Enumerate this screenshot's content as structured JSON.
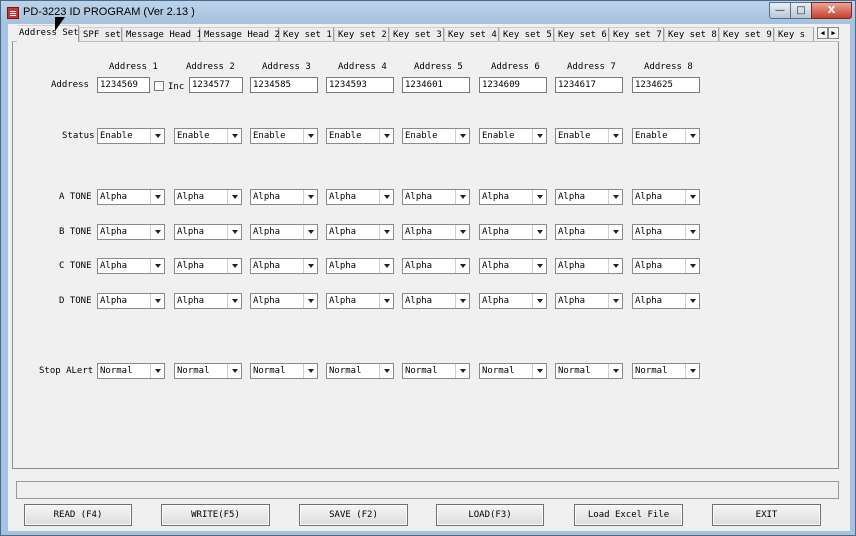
{
  "window": {
    "title": "PD-3223 ID PROGRAM (Ver 2.13 )",
    "caption_minimize": "—",
    "caption_maximize": "□",
    "caption_close": "X"
  },
  "tabs": [
    "Address Set",
    "SPF set",
    "Message Head 1",
    "Message Head 2",
    "Key set 1",
    "Key set 2",
    "Key set 3",
    "Key set 4",
    "Key set 5",
    "Key set 6",
    "Key set 7",
    "Key set 8",
    "Key set 9",
    "Key s"
  ],
  "active_tab": "Address Set",
  "tab_arrows": {
    "left": "◀",
    "right": "▶"
  },
  "form": {
    "row_labels": {
      "address": "Address",
      "status": "Status",
      "a_tone": "A TONE",
      "b_tone": "B TONE",
      "c_tone": "C TONE",
      "d_tone": "D TONE",
      "stop_alert": "Stop ALert"
    },
    "inc_label": "Inc",
    "inc_checked": false,
    "columns": [
      {
        "header": "Address 1",
        "address": "1234569",
        "status": "Enable",
        "a": "Alpha",
        "b": "Alpha",
        "c": "Alpha",
        "d": "Alpha",
        "stop": "Normal"
      },
      {
        "header": "Address  2",
        "address": "1234577",
        "status": "Enable",
        "a": "Alpha",
        "b": "Alpha",
        "c": "Alpha",
        "d": "Alpha",
        "stop": "Normal"
      },
      {
        "header": "Address  3",
        "address": "1234585",
        "status": "Enable",
        "a": "Alpha",
        "b": "Alpha",
        "c": "Alpha",
        "d": "Alpha",
        "stop": "Normal"
      },
      {
        "header": "Address  4",
        "address": "1234593",
        "status": "Enable",
        "a": "Alpha",
        "b": "Alpha",
        "c": "Alpha",
        "d": "Alpha",
        "stop": "Normal"
      },
      {
        "header": "Address  5",
        "address": "1234601",
        "status": "Enable",
        "a": "Alpha",
        "b": "Alpha",
        "c": "Alpha",
        "d": "Alpha",
        "stop": "Normal"
      },
      {
        "header": "Address  6",
        "address": "1234609",
        "status": "Enable",
        "a": "Alpha",
        "b": "Alpha",
        "c": "Alpha",
        "d": "Alpha",
        "stop": "Normal"
      },
      {
        "header": "Address  7",
        "address": "1234617",
        "status": "Enable",
        "a": "Alpha",
        "b": "Alpha",
        "c": "Alpha",
        "d": "Alpha",
        "stop": "Normal"
      },
      {
        "header": "Address  8",
        "address": "1234625",
        "status": "Enable",
        "a": "Alpha",
        "b": "Alpha",
        "c": "Alpha",
        "d": "Alpha",
        "stop": "Normal"
      }
    ]
  },
  "status_bar": {
    "text": ""
  },
  "buttons": {
    "read": "READ  (F4)",
    "write": "WRITE(F5)",
    "save": "SAVE   (F2)",
    "load": "LOAD(F3)",
    "load_excel": "Load Excel File",
    "exit": "EXIT"
  },
  "icons": {
    "app": "app-icon",
    "combo_arrow": "chevron-down-icon",
    "cursor": "mouse-pointer-icon"
  }
}
